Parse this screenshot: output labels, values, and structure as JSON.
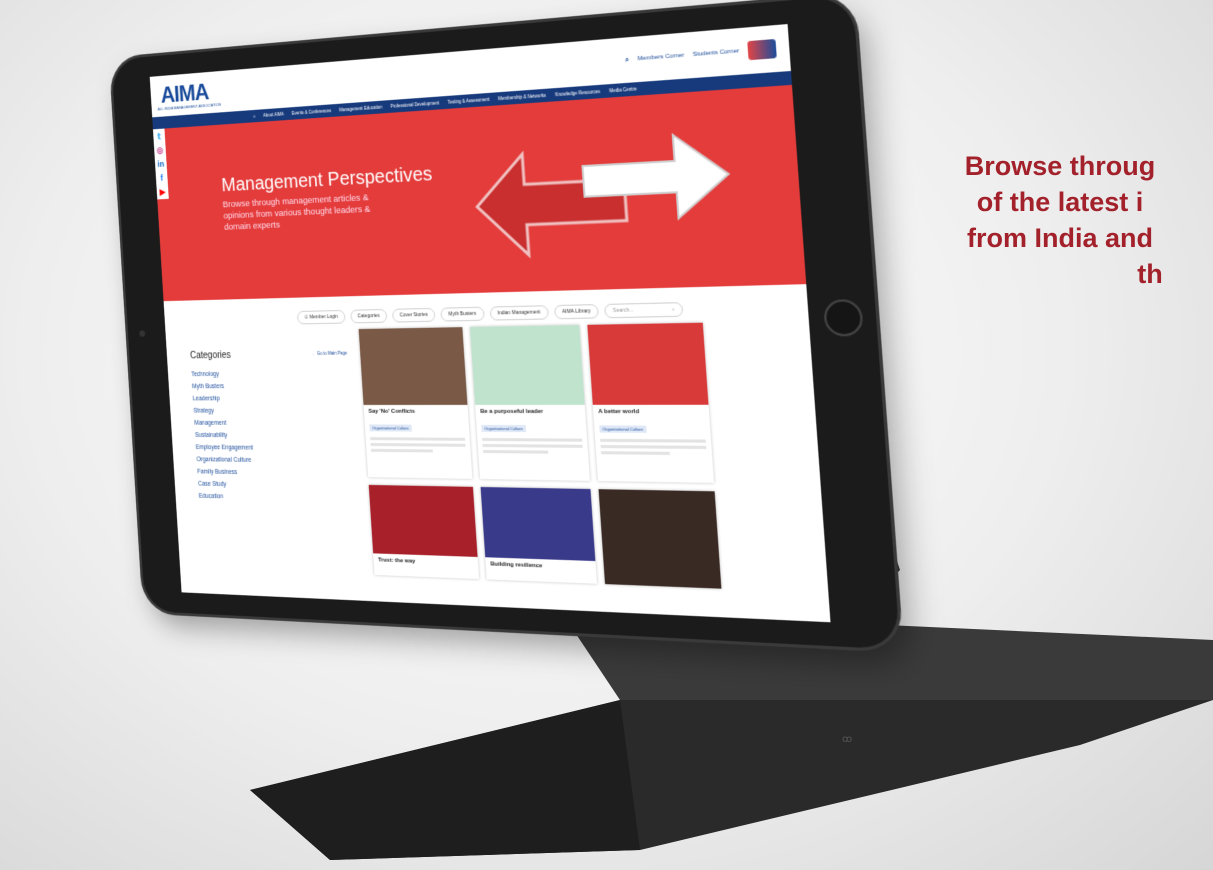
{
  "promo": {
    "lines": [
      "Browse throug",
      "of the latest i",
      "from India and",
      "th"
    ]
  },
  "site": {
    "logo": "AIMA",
    "logo_sub": "ALL INDIA MANAGEMENT ASSOCIATION",
    "header_links": [
      "Members Corner",
      "Students Corner"
    ],
    "nav": [
      "About AIMA",
      "Events & Conferences",
      "Management Education",
      "Professional Development",
      "Testing & Assessment",
      "Membership & Networks",
      "Knowledge Resources",
      "Media Centre"
    ],
    "social_icons": [
      "twitter-icon",
      "instagram-icon",
      "linkedin-icon",
      "facebook-icon",
      "youtube-icon"
    ]
  },
  "hero": {
    "title": "Management Perspectives",
    "subtitle": "Browse through management articles & opinions from various thought leaders & domain experts",
    "accent_color": "#e43b3b"
  },
  "filters": {
    "items": [
      "Member Login",
      "Categories",
      "Cover Stories",
      "Myth Busters",
      "Indian Management",
      "AIMA Library"
    ],
    "search_placeholder": "Search...",
    "search_icon": "search-icon"
  },
  "categories": {
    "title": "Categories",
    "back_link": "Go to Main Page",
    "items": [
      "Technology",
      "Myth Busters",
      "Leadership",
      "Strategy",
      "Management",
      "Sustainability",
      "Employee Engagement",
      "Organizational Culture",
      "Family Business",
      "Case Study",
      "Education"
    ]
  },
  "cards": [
    {
      "title": "Say 'No' Conflicts",
      "badge": "Organisational Culture",
      "color": "#7a5a46"
    },
    {
      "title": "Be a purposeful leader",
      "badge": "Organisational Culture",
      "color": "#bfe3cc"
    },
    {
      "title": "A better world",
      "badge": "Organisational Culture",
      "color": "#d83a3a"
    },
    {
      "title": "Trust: the way",
      "badge": "",
      "color": "#a8202a"
    },
    {
      "title": "Building resilience",
      "badge": "",
      "color": "#3a3a8a"
    },
    {
      "title": "",
      "badge": "",
      "color": "#3a2a24"
    }
  ],
  "colors": {
    "brand_blue": "#1b4c9b",
    "nav_blue": "#173a7c",
    "promo_red": "#a3212b"
  }
}
